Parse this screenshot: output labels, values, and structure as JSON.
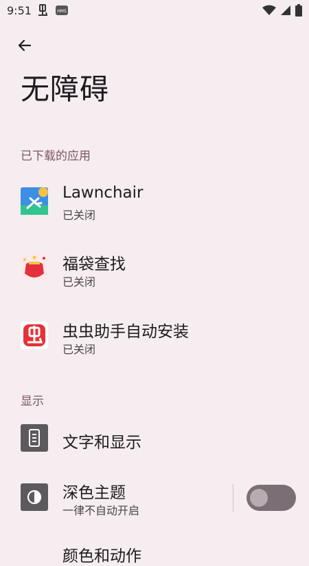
{
  "status": {
    "time": "9:51",
    "hms_label": "HMS"
  },
  "page": {
    "title": "无障碍"
  },
  "sections": {
    "downloaded": "已下载的应用",
    "display": "显示"
  },
  "apps": [
    {
      "title": "Lawnchair",
      "subtitle": "已关闭"
    },
    {
      "title": "福袋查找",
      "subtitle": "已关闭"
    },
    {
      "title": "虫虫助手自动安装",
      "subtitle": "已关闭"
    }
  ],
  "display_items": [
    {
      "title": "文字和显示"
    },
    {
      "title": "深色主题",
      "subtitle": "一律不自动开启",
      "toggle_on": false
    }
  ],
  "partial_item": {
    "title": "颜色和动作"
  },
  "colors": {
    "background": "#f6edf0",
    "section_header": "#7d5560",
    "toggle_track": "#7b6f75"
  }
}
